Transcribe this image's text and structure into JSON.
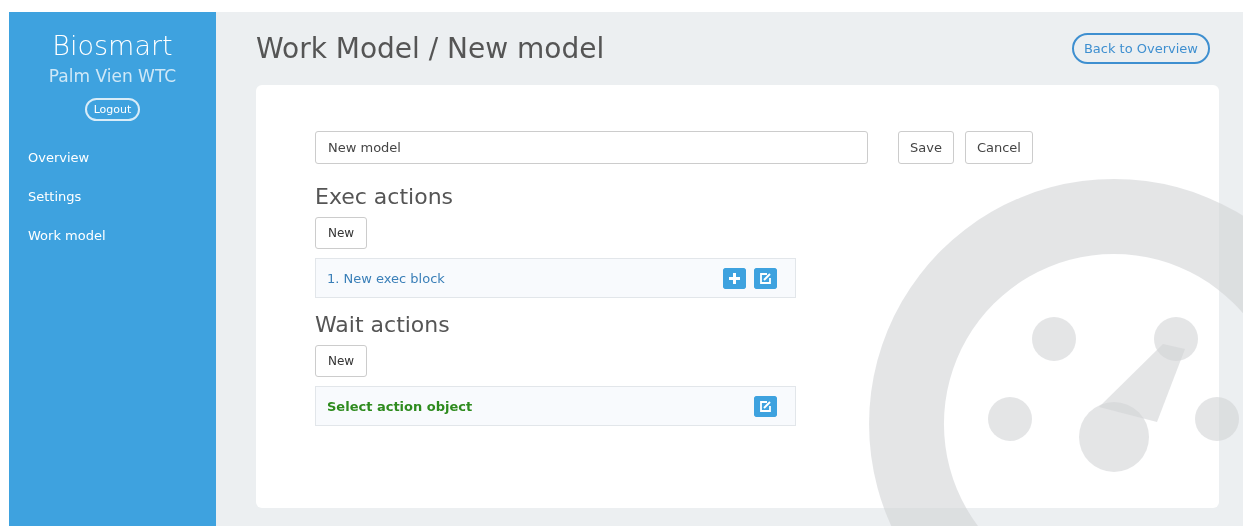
{
  "sidebar": {
    "brand": "Biosmart",
    "site": "Palm Vien WTC",
    "logout": "Logout",
    "items": [
      {
        "label": "Overview"
      },
      {
        "label": "Settings"
      },
      {
        "label": "Work model"
      }
    ]
  },
  "header": {
    "title": "Work Model / New model",
    "back": "Back to Overview"
  },
  "form": {
    "name_value": "New model",
    "save": "Save",
    "cancel": "Cancel"
  },
  "sections": [
    {
      "kind": "exec",
      "title": "Exec actions",
      "new": "New",
      "rows": [
        {
          "label": "1. New exec block"
        }
      ]
    },
    {
      "kind": "wait",
      "title": "Wait actions",
      "new": "New",
      "rows": [
        {
          "label": "Select action object"
        }
      ]
    }
  ]
}
